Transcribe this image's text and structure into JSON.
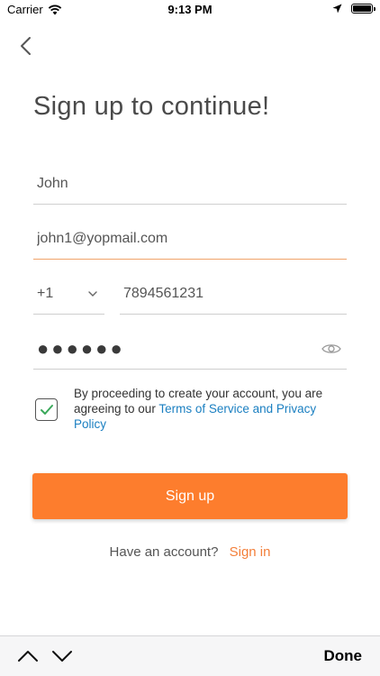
{
  "status_bar": {
    "carrier": "Carrier",
    "time": "9:13 PM",
    "icons": [
      "wifi-icon",
      "location-arrow-icon",
      "battery-icon"
    ]
  },
  "nav": {
    "back_icon": "chevron-left-icon"
  },
  "title": "Sign up to continue!",
  "form": {
    "name_value": "John",
    "email_value": "john1@yopmail.com",
    "country_code": "+1",
    "phone_value": "7894561231",
    "password_mask": "●●●●●●",
    "password_toggle_icon": "eye-icon"
  },
  "agreement": {
    "checked": true,
    "text_prefix": "By proceeding to create your account, you are agreeing to our ",
    "link_text": "Terms of Service and Privacy Policy"
  },
  "signup_label": "Sign up",
  "signin": {
    "prompt": "Have an account?",
    "link": "Sign in"
  },
  "keyboard_bar": {
    "done_label": "Done",
    "prev_icon": "chevron-up-icon",
    "next_icon": "chevron-down-icon"
  },
  "colors": {
    "accent": "#fd7d2d",
    "link": "#1a7fc1",
    "checkbox_check": "#3aa85a",
    "active_underline": "#f0a36a"
  }
}
